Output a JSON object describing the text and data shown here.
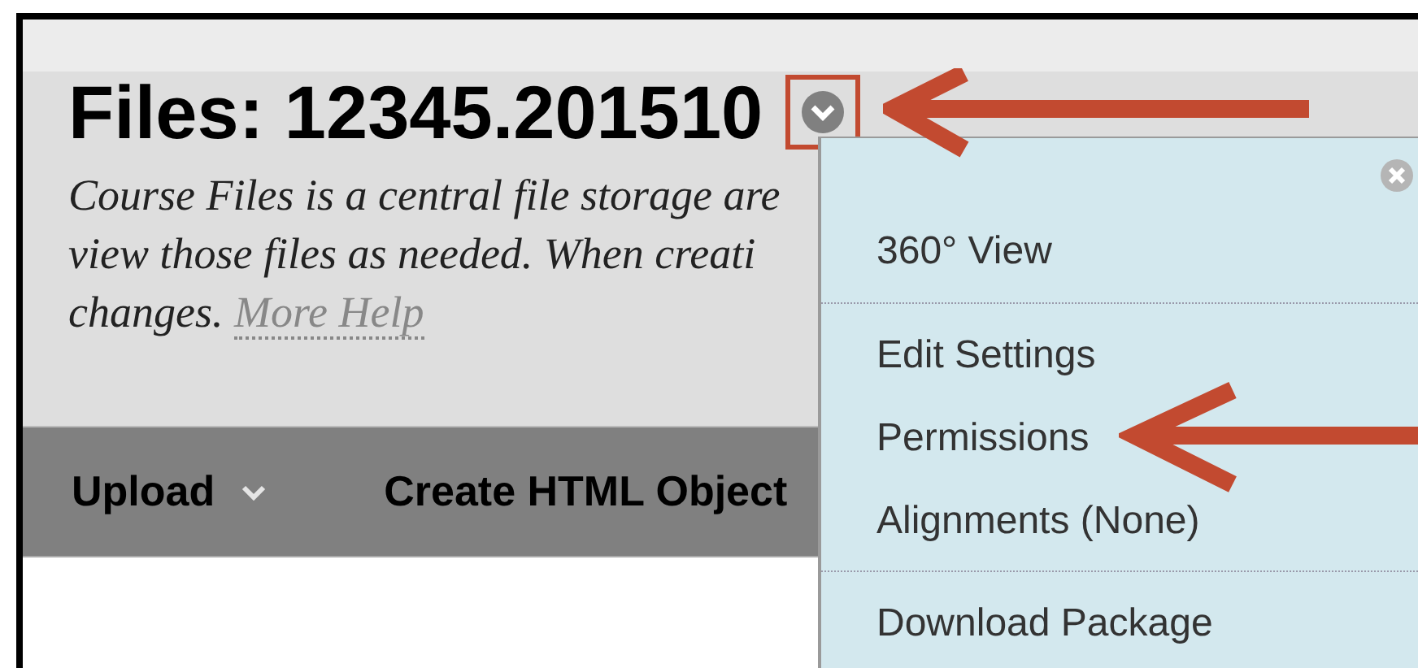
{
  "page": {
    "title": "Files: 12345.201510",
    "description_lines": [
      "Course Files is a central file storage are",
      "view those files as needed. When creati",
      "changes."
    ],
    "help_link": "More Help"
  },
  "toolbar": [
    {
      "label": "Upload",
      "has_menu": true
    },
    {
      "label": "Create HTML Object",
      "has_menu": false
    }
  ],
  "menu": {
    "groups": [
      [
        "360° View"
      ],
      [
        "Edit Settings",
        "Permissions",
        "Alignments (None)"
      ],
      [
        "Download Package"
      ]
    ]
  }
}
